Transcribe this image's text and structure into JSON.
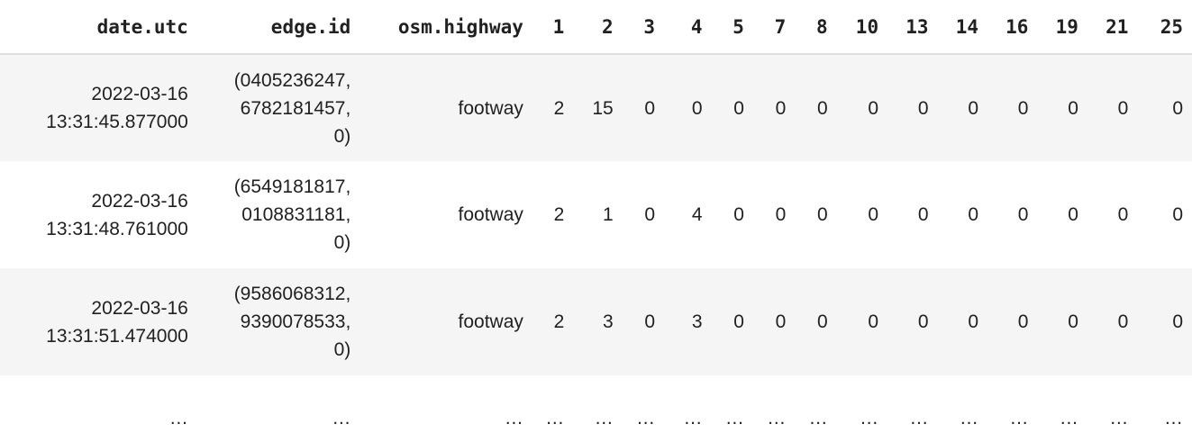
{
  "table": {
    "columns": [
      "date.utc",
      "edge.id",
      "osm.highway",
      "1",
      "2",
      "3",
      "4",
      "5",
      "7",
      "8",
      "10",
      "13",
      "14",
      "16",
      "19",
      "21",
      "25"
    ],
    "rows": [
      {
        "date": [
          "2022-03-16",
          "13:31:45.877000"
        ],
        "edge": [
          "(0405236247,",
          "6782181457,",
          "0)"
        ],
        "cells": [
          "footway",
          "2",
          "15",
          "0",
          "0",
          "0",
          "0",
          "0",
          "0",
          "0",
          "0",
          "0",
          "0",
          "0",
          "0"
        ]
      },
      {
        "date": [
          "2022-03-16",
          "13:31:48.761000"
        ],
        "edge": [
          "(6549181817,",
          "0108831181,",
          "0)"
        ],
        "cells": [
          "footway",
          "2",
          "1",
          "0",
          "4",
          "0",
          "0",
          "0",
          "0",
          "0",
          "0",
          "0",
          "0",
          "0",
          "0"
        ]
      },
      {
        "date": [
          "2022-03-16",
          "13:31:51.474000"
        ],
        "edge": [
          "(9586068312,",
          "9390078533,",
          "0)"
        ],
        "cells": [
          "footway",
          "2",
          "3",
          "0",
          "3",
          "0",
          "0",
          "0",
          "0",
          "0",
          "0",
          "0",
          "0",
          "0",
          "0"
        ]
      }
    ],
    "ellipsis": [
      "…",
      "…",
      "…",
      "…",
      "…",
      "…",
      "…",
      "…",
      "…",
      "…",
      "…",
      "…",
      "…",
      "…",
      "…",
      "…",
      "…"
    ]
  }
}
